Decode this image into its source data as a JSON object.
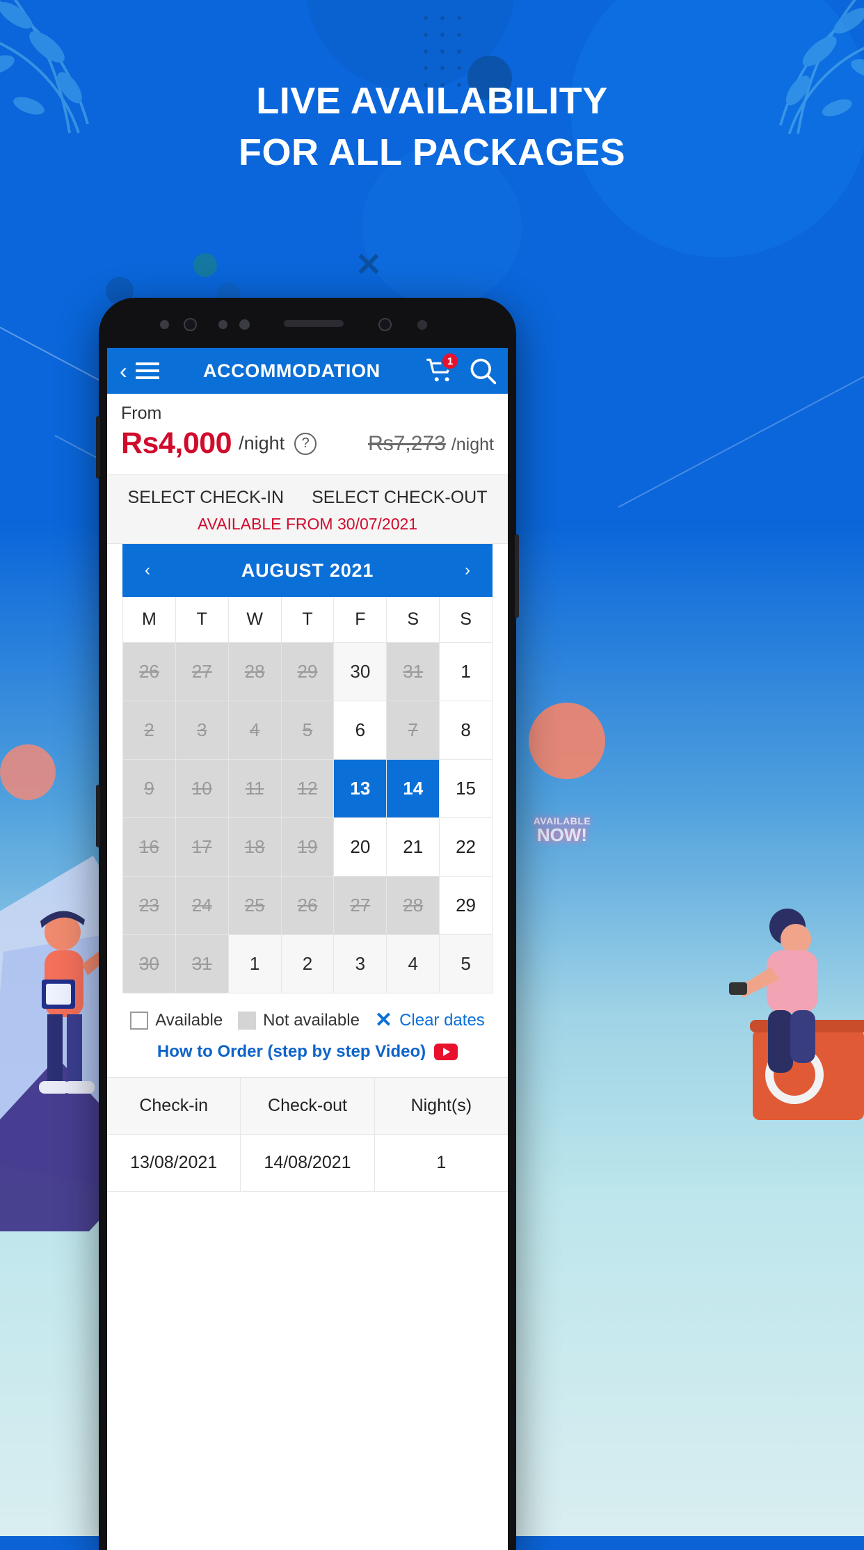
{
  "hero": {
    "line1": "LIVE AVAILABILITY",
    "line2": "FOR ALL PACKAGES"
  },
  "decor": {
    "neon_line1": "AVAILABLE",
    "neon_line2": "NOW!",
    "x_mark": "✕"
  },
  "app": {
    "header": {
      "back_icon": "‹",
      "menu_icon": "hamburger-menu-icon",
      "title": "ACCOMMODATION",
      "cart_badge": "1",
      "cart_icon": "shopping-cart-icon",
      "search_icon": "search-icon"
    },
    "price": {
      "from_label": "From",
      "amount": "Rs4,000",
      "unit": "/night",
      "help_icon": "?",
      "old_amount": "Rs7,273",
      "old_unit": "/night"
    },
    "select": {
      "checkin_label": "SELECT CHECK-IN",
      "checkout_label": "SELECT CHECK-OUT",
      "available_note": "AVAILABLE FROM 30/07/2021"
    },
    "calendar": {
      "prev_icon": "‹",
      "next_icon": "›",
      "month_label": "AUGUST 2021",
      "dow": [
        "M",
        "T",
        "W",
        "T",
        "F",
        "S",
        "S"
      ],
      "weeks": [
        [
          {
            "d": "26",
            "s": "muted"
          },
          {
            "d": "27",
            "s": "muted"
          },
          {
            "d": "28",
            "s": "muted"
          },
          {
            "d": "29",
            "s": "muted"
          },
          {
            "d": "30",
            "s": "dim"
          },
          {
            "d": "31",
            "s": "muted"
          },
          {
            "d": "1",
            "s": "open"
          }
        ],
        [
          {
            "d": "2",
            "s": "muted"
          },
          {
            "d": "3",
            "s": "muted"
          },
          {
            "d": "4",
            "s": "muted"
          },
          {
            "d": "5",
            "s": "muted"
          },
          {
            "d": "6",
            "s": "open"
          },
          {
            "d": "7",
            "s": "muted"
          },
          {
            "d": "8",
            "s": "open"
          }
        ],
        [
          {
            "d": "9",
            "s": "muted"
          },
          {
            "d": "10",
            "s": "muted"
          },
          {
            "d": "11",
            "s": "muted"
          },
          {
            "d": "12",
            "s": "muted"
          },
          {
            "d": "13",
            "s": "sel"
          },
          {
            "d": "14",
            "s": "sel"
          },
          {
            "d": "15",
            "s": "open"
          }
        ],
        [
          {
            "d": "16",
            "s": "muted"
          },
          {
            "d": "17",
            "s": "muted"
          },
          {
            "d": "18",
            "s": "muted"
          },
          {
            "d": "19",
            "s": "muted"
          },
          {
            "d": "20",
            "s": "open"
          },
          {
            "d": "21",
            "s": "open"
          },
          {
            "d": "22",
            "s": "open"
          }
        ],
        [
          {
            "d": "23",
            "s": "muted"
          },
          {
            "d": "24",
            "s": "muted"
          },
          {
            "d": "25",
            "s": "muted"
          },
          {
            "d": "26",
            "s": "muted"
          },
          {
            "d": "27",
            "s": "muted"
          },
          {
            "d": "28",
            "s": "muted"
          },
          {
            "d": "29",
            "s": "open"
          }
        ],
        [
          {
            "d": "30",
            "s": "muted"
          },
          {
            "d": "31",
            "s": "muted"
          },
          {
            "d": "1",
            "s": "dim"
          },
          {
            "d": "2",
            "s": "dim"
          },
          {
            "d": "3",
            "s": "dim"
          },
          {
            "d": "4",
            "s": "dim"
          },
          {
            "d": "5",
            "s": "dim"
          }
        ]
      ]
    },
    "legend": {
      "available_label": "Available",
      "not_available_label": "Not available",
      "clear_icon": "✕",
      "clear_label": "Clear dates",
      "howto_label": "How to Order (step by step Video)",
      "youtube_icon": "youtube-icon"
    },
    "summary": {
      "headers": [
        "Check-in",
        "Check-out",
        "Night(s)"
      ],
      "values": [
        "13/08/2021",
        "14/08/2021",
        "1"
      ]
    }
  },
  "colors": {
    "brand_blue": "#0b6fd8",
    "price_red": "#d10b2c",
    "badge_red": "#e8112d",
    "muted_gray": "#d8d8d8"
  }
}
